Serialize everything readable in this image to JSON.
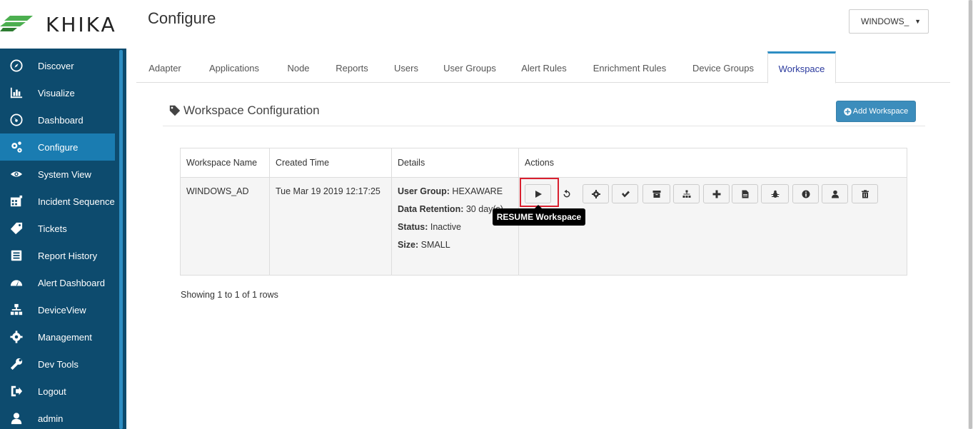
{
  "brand": {
    "logo_text": "KHIKA",
    "accent": "#2e8ec3",
    "sidebar_bg": "#0d4b6e",
    "logo_green": "#4caf50"
  },
  "header": {
    "title": "Configure",
    "workspace_select": "WINDOWS_"
  },
  "sidebar": {
    "items": [
      {
        "label": "Discover",
        "icon": "compass-icon"
      },
      {
        "label": "Visualize",
        "icon": "bar-chart-icon"
      },
      {
        "label": "Dashboard",
        "icon": "dashboard-icon"
      },
      {
        "label": "Configure",
        "icon": "cogs-icon",
        "active": true
      },
      {
        "label": "System View",
        "icon": "eye-icon"
      },
      {
        "label": "Incident Sequence",
        "icon": "calendar-icon"
      },
      {
        "label": "Tickets",
        "icon": "tag-icon"
      },
      {
        "label": "Report History",
        "icon": "list-alt-icon"
      },
      {
        "label": "Alert Dashboard",
        "icon": "gauge-icon"
      },
      {
        "label": "DeviceView",
        "icon": "sitemap-icon"
      },
      {
        "label": "Management",
        "icon": "gear-icon"
      },
      {
        "label": "Dev Tools",
        "icon": "wrench-icon"
      },
      {
        "label": "Logout",
        "icon": "logout-icon"
      },
      {
        "label": "admin",
        "icon": "user-icon"
      }
    ]
  },
  "tabs": [
    {
      "label": "Adapter"
    },
    {
      "label": "Applications"
    },
    {
      "label": "Node"
    },
    {
      "label": "Reports"
    },
    {
      "label": "Users"
    },
    {
      "label": "User Groups"
    },
    {
      "label": "Alert Rules"
    },
    {
      "label": "Enrichment Rules"
    },
    {
      "label": "Device Groups"
    },
    {
      "label": "Workspace",
      "active": true
    }
  ],
  "section": {
    "title": "Workspace Configuration",
    "add_button": "Add Workspace"
  },
  "table": {
    "columns": [
      "Workspace Name",
      "Created Time",
      "Details",
      "Actions"
    ],
    "rows": [
      {
        "workspace_name": "WINDOWS_AD",
        "created_time": "Tue Mar 19 2019 12:17:25",
        "details": {
          "user_group_label": "User Group:",
          "user_group": "HEXAWARE",
          "retention_label": "Data Retention:",
          "retention": "30 day(s)",
          "status_label": "Status:",
          "status": "Inactive",
          "size_label": "Size:",
          "size": "SMALL"
        }
      }
    ],
    "actions": [
      "play-icon",
      "undo-icon",
      "gear-icon",
      "check-icon",
      "archive-icon",
      "sitemap-icon",
      "plus-icon",
      "file-icon",
      "bug-icon",
      "info-icon",
      "user-icon",
      "trash-icon"
    ],
    "tooltip": "RESUME Workspace",
    "footer": "Showing 1 to 1 of 1 rows"
  }
}
